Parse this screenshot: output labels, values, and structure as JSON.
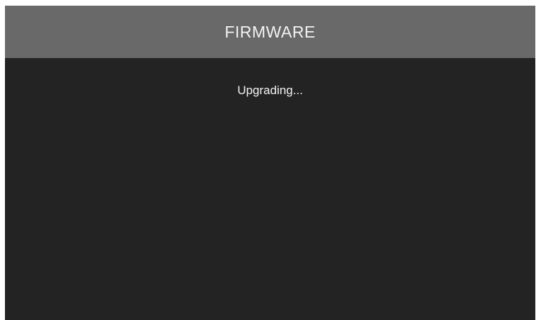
{
  "header": {
    "title": "FIRMWARE"
  },
  "main": {
    "status": "Upgrading..."
  },
  "colors": {
    "header_bg": "#696969",
    "body_bg": "#232323",
    "text": "#f2f2f2"
  }
}
